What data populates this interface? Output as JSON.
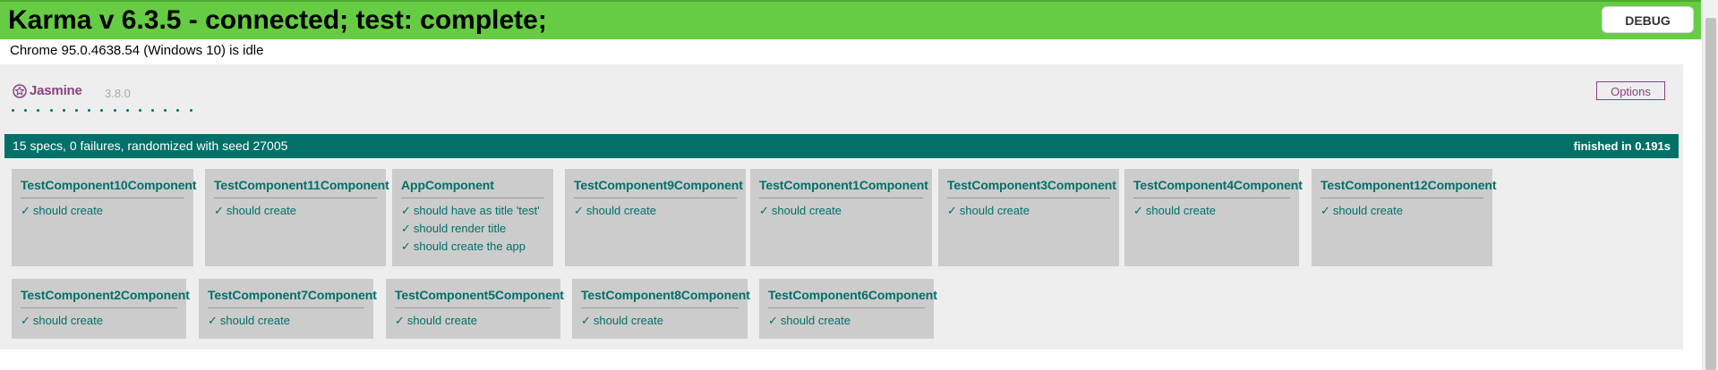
{
  "banner": {
    "title": "Karma v 6.3.5 - connected; test: complete;",
    "debug_label": "DEBUG",
    "browser_status": "Chrome 95.0.4638.54 (Windows 10) is idle"
  },
  "jasmine": {
    "name": "Jasmine",
    "version": "3.8.0",
    "options_label": "Options",
    "passed_dot_count": 15
  },
  "summary": {
    "text": "15 specs, 0 failures, randomized with seed 27005",
    "duration": "finished in 0.191s"
  },
  "check_symbol": "✓",
  "suites": [
    {
      "title": "TestComponent10Component",
      "specs": [
        "should create"
      ]
    },
    {
      "title": "TestComponent11Component",
      "specs": [
        "should create"
      ]
    },
    {
      "title": "AppComponent",
      "specs": [
        "should have as title 'test'",
        "should render title",
        "should create the app"
      ]
    },
    {
      "title": "TestComponent9Component",
      "specs": [
        "should create"
      ]
    },
    {
      "title": "TestComponent1Component",
      "specs": [
        "should create"
      ]
    },
    {
      "title": "TestComponent3Component",
      "specs": [
        "should create"
      ]
    },
    {
      "title": "TestComponent4Component",
      "specs": [
        "should create"
      ]
    },
    {
      "title": "TestComponent12Component",
      "specs": [
        "should create"
      ]
    },
    {
      "title": "TestComponent2Component",
      "specs": [
        "should create"
      ]
    },
    {
      "title": "TestComponent7Component",
      "specs": [
        "should create"
      ]
    },
    {
      "title": "TestComponent5Component",
      "specs": [
        "should create"
      ]
    },
    {
      "title": "TestComponent8Component",
      "specs": [
        "should create"
      ]
    },
    {
      "title": "TestComponent6Component",
      "specs": [
        "should create"
      ]
    }
  ],
  "colors": {
    "banner_green": "#66cc44",
    "jasmine_teal": "#007069",
    "jasmine_purple": "#8a4182",
    "suite_gray": "#cccccc"
  }
}
